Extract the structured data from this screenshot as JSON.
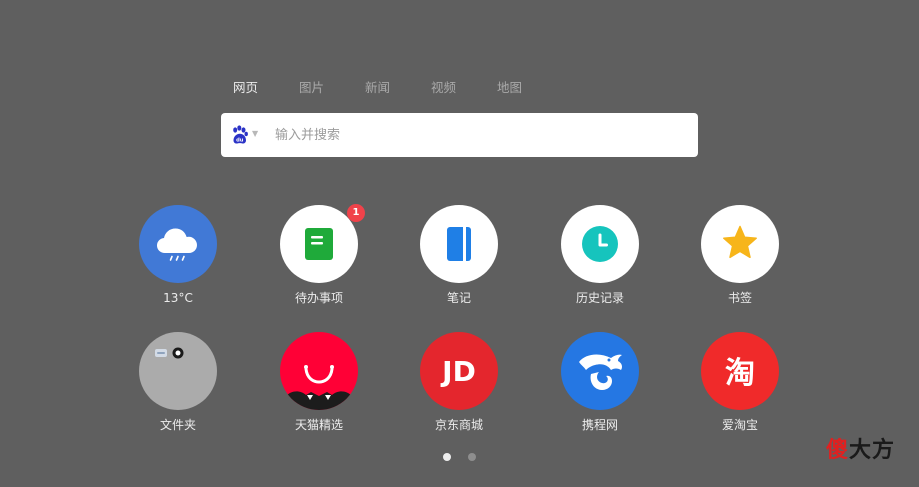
{
  "tabs": [
    {
      "label": "网页",
      "active": true
    },
    {
      "label": "图片",
      "active": false
    },
    {
      "label": "新闻",
      "active": false
    },
    {
      "label": "视频",
      "active": false
    },
    {
      "label": "地图",
      "active": false
    }
  ],
  "search": {
    "placeholder": "输入并搜索",
    "engine_icon": "baidu-paw-icon",
    "dropdown_icon": "caret-down-icon"
  },
  "shortcuts": [
    {
      "label": "13°C",
      "icon": "weather-cloud-icon",
      "color": "#4179d6"
    },
    {
      "label": "待办事项",
      "icon": "todo-note-icon",
      "color": "#1faa3a",
      "badge": "1"
    },
    {
      "label": "笔记",
      "icon": "notebook-icon",
      "color": "#1f7fe6"
    },
    {
      "label": "历史记录",
      "icon": "clock-icon",
      "color": "#16c4bd"
    },
    {
      "label": "书签",
      "icon": "star-icon",
      "color": "#f7b51a"
    },
    {
      "label": "文件夹",
      "icon": "folder-icon",
      "color": "#ababab"
    },
    {
      "label": "天猫精选",
      "icon": "tmall-icon",
      "color": "#ff0036"
    },
    {
      "label": "京东商城",
      "icon": "jd-icon",
      "color": "#e4262d",
      "logo_text": "JD"
    },
    {
      "label": "携程网",
      "icon": "ctrip-dolphin-icon",
      "color": "#2577e3"
    },
    {
      "label": "爱淘宝",
      "icon": "taobao-icon",
      "color": "#f02a2a",
      "logo_text": "淘"
    }
  ],
  "pagination": {
    "pages": 2,
    "current": 1
  },
  "watermark": {
    "part1": "傻",
    "part2": "大方"
  }
}
